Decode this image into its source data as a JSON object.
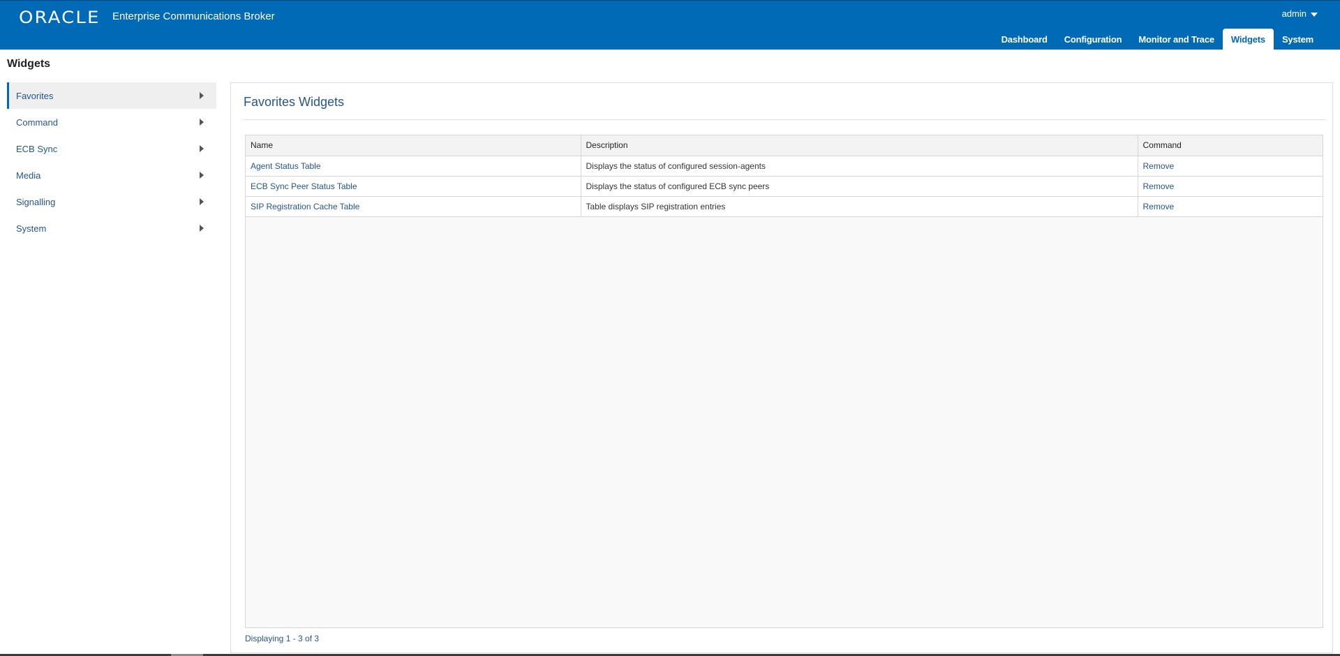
{
  "header": {
    "logo": "ORACLE",
    "product": "Enterprise Communications Broker",
    "user": "admin",
    "nav": [
      "Dashboard",
      "Configuration",
      "Monitor and Trace",
      "Widgets",
      "System"
    ],
    "active_nav": "Widgets"
  },
  "page": {
    "title": "Widgets"
  },
  "sidebar": {
    "items": [
      {
        "label": "Favorites"
      },
      {
        "label": "Command"
      },
      {
        "label": "ECB Sync"
      },
      {
        "label": "Media"
      },
      {
        "label": "Signalling"
      },
      {
        "label": "System"
      }
    ],
    "active": "Favorites"
  },
  "main": {
    "title": "Favorites Widgets",
    "table": {
      "columns": [
        "Name",
        "Description",
        "Command"
      ],
      "rows": [
        {
          "name": "Agent Status Table",
          "description": "Displays the status of configured session-agents",
          "command": "Remove"
        },
        {
          "name": "ECB Sync Peer Status Table",
          "description": "Displays the status of configured ECB sync peers",
          "command": "Remove"
        },
        {
          "name": "SIP Registration Cache Table",
          "description": "Table displays SIP registration entries",
          "command": "Remove"
        }
      ]
    },
    "footer": "Displaying 1 - 3 of 3"
  },
  "icons": {
    "user_menu": "chevron-down-icon",
    "sidebar_item": "caret-right-icon"
  },
  "colors": {
    "brand": "#006ab6",
    "link": "#24558f"
  }
}
